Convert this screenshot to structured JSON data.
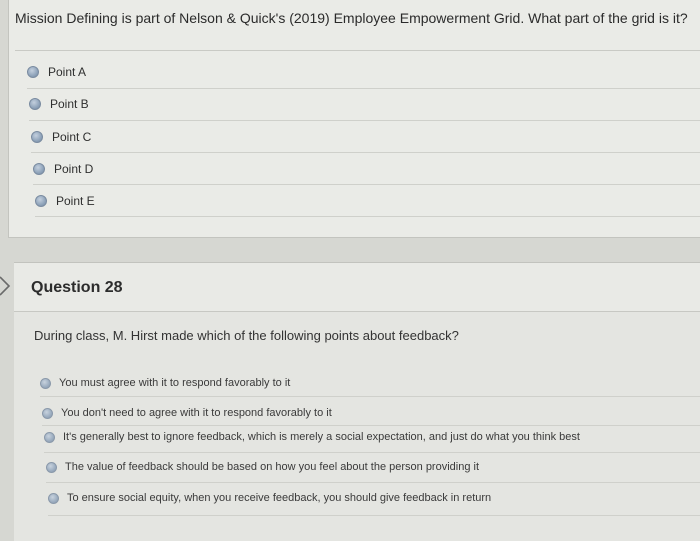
{
  "question27": {
    "text": "Mission Defining is part of Nelson & Quick's (2019) Employee Empowerment Grid. What part of the grid is it?",
    "options": [
      "Point A",
      "Point B",
      "Point C",
      "Point D",
      "Point E"
    ]
  },
  "question28": {
    "title": "Question 28",
    "text": "During class, M. Hirst made which of the following points about feedback?",
    "options": [
      "You must agree with it to respond favorably to it",
      "You don't need to agree with it to respond favorably to it",
      "It's generally best to ignore feedback, which is merely a social expectation, and just do what you think best",
      "The value of feedback should be based on how you feel about the person providing it",
      "To ensure social equity, when you receive feedback, you should give feedback in return"
    ]
  },
  "icons": {
    "question_arrow": "chevron-right-icon",
    "radio": "radio-unselected-icon"
  },
  "colors": {
    "background": "#d6d7d2",
    "card": "#eaebe7",
    "radio": "#8fa3ba"
  }
}
